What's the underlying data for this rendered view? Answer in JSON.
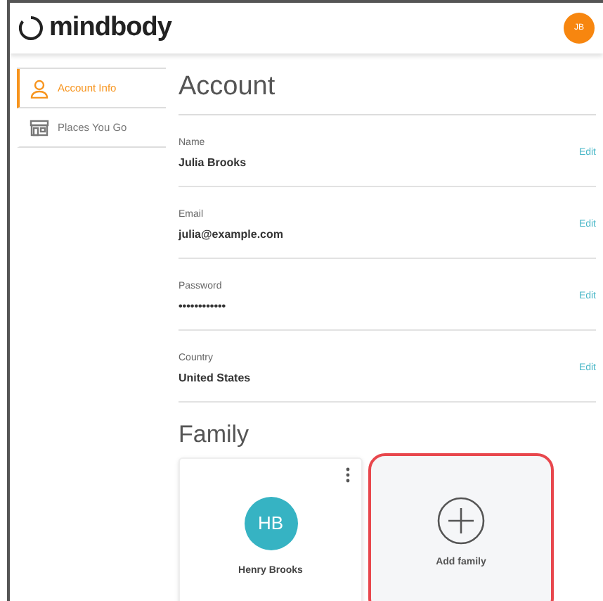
{
  "header": {
    "logo": "mindbody",
    "avatar": "JB"
  },
  "sidebar": {
    "items": [
      {
        "label": "Account Info",
        "kind": "person",
        "selected": true
      },
      {
        "label": "Places You Go",
        "kind": "store",
        "selected": false
      }
    ]
  },
  "account": {
    "title": "Account",
    "fields": [
      {
        "label": "Name",
        "value": "Julia Brooks",
        "action": "Edit"
      },
      {
        "label": "Email",
        "value": "julia@example.com",
        "action": "Edit"
      },
      {
        "label": "Password",
        "value": "••••••••••••",
        "action": "Edit"
      },
      {
        "label": "Country",
        "value": "United States",
        "action": "Edit"
      }
    ]
  },
  "family": {
    "title": "Family",
    "cards": [
      {
        "kind": "member",
        "initials": "HB",
        "name": "Henry Brooks",
        "highlighted": false
      },
      {
        "kind": "add",
        "name": "Add family",
        "highlighted": true
      }
    ]
  }
}
